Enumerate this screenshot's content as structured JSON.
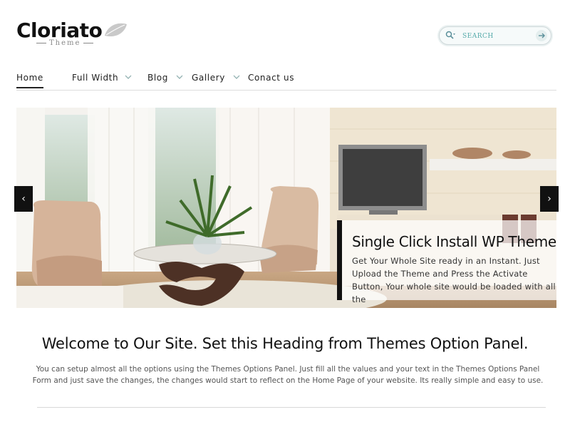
{
  "brand": {
    "name": "Cloriato",
    "tagline": "Theme",
    "leaf_icon": "leaf-icon"
  },
  "search": {
    "placeholder": "SEARCH",
    "value": "",
    "icon": "search-icon",
    "submit_icon": "arrow-right-icon"
  },
  "nav": {
    "items": [
      {
        "label": "Home",
        "active": true,
        "has_dropdown": false
      },
      {
        "label": "Full Width",
        "active": false,
        "has_dropdown": true
      },
      {
        "label": "Blog",
        "active": false,
        "has_dropdown": true
      },
      {
        "label": "Gallery",
        "active": false,
        "has_dropdown": true
      },
      {
        "label": "Conact us",
        "active": false,
        "has_dropdown": false
      }
    ]
  },
  "slider": {
    "prev_label": "‹",
    "next_label": "›",
    "caption_title": "Single Click Install WP Theme",
    "caption_body": "Get Your Whole Site ready in an Instant. Just Upload the Theme and Press the Activate Button, Your whole site would be loaded with all the"
  },
  "welcome": {
    "heading": "Welcome to Our Site. Set this Heading from Themes Option Panel.",
    "text": "You can setup almost all the options using the Themes Options Panel. Just fill all the values and your text in the Themes Options Panel Form and just save the changes, the changes would start to reflect on the Home Page of your website. Its really simple and easy to use."
  },
  "colors": {
    "accent": "#111111",
    "search_text": "#55aaaa",
    "background": "#ffffff"
  }
}
